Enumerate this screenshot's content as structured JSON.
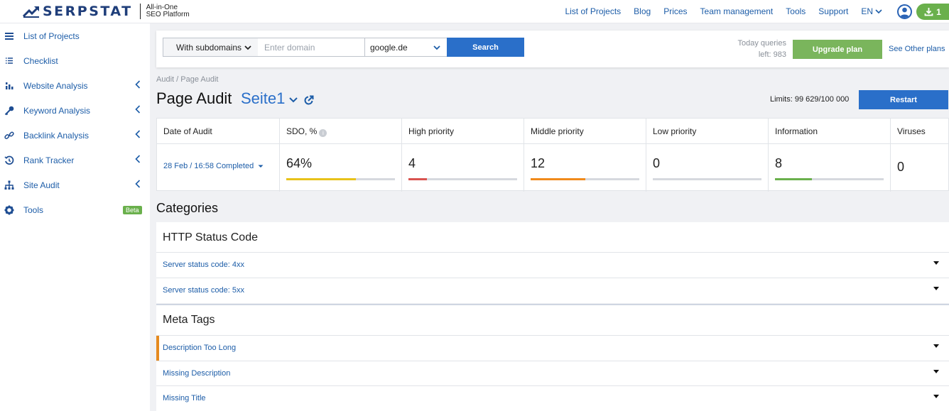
{
  "header": {
    "logo_text": "SERPSTAT",
    "tagline_line1": "All-in-One",
    "tagline_line2": "SEO Platform",
    "nav": [
      "List of Projects",
      "Blog",
      "Prices",
      "Team management",
      "Tools",
      "Support"
    ],
    "language": "EN",
    "notifications_count": "1"
  },
  "sidebar": {
    "items": [
      {
        "label": "List of Projects",
        "icon": "menu-icon"
      },
      {
        "label": "Checklist",
        "icon": "checklist-icon"
      },
      {
        "label": "Website Analysis",
        "icon": "bar-chart-icon"
      },
      {
        "label": "Keyword Analysis",
        "icon": "key-icon"
      },
      {
        "label": "Backlink Analysis",
        "icon": "link-icon"
      },
      {
        "label": "Rank Tracker",
        "icon": "history-icon"
      },
      {
        "label": "Site Audit",
        "icon": "sitemap-icon"
      },
      {
        "label": "Tools",
        "icon": "gear-icon"
      }
    ],
    "beta_label": "Beta"
  },
  "search": {
    "scope": "With subdomains",
    "domain_placeholder": "Enter domain",
    "search_engine": "google.de",
    "search_button": "Search",
    "queries_line1": "Today queries",
    "queries_line2": "left: 983",
    "upgrade_button": "Upgrade plan",
    "other_plans_link": "See Other plans"
  },
  "page": {
    "breadcrumb": "Audit / Page Audit",
    "title": "Page Audit",
    "project": "Seite1",
    "limits": "Limits: 99 629/100 000",
    "restart_button": "Restart"
  },
  "stats": {
    "date_header": "Date of Audit",
    "date_value": "28 Feb / 16:58 Completed",
    "columns": [
      {
        "header": "SDO, %",
        "value": "64%",
        "fill": 0.64,
        "color": "#e8c21a"
      },
      {
        "header": "High priority",
        "value": "4",
        "fill": 0.17,
        "color": "#d9534f"
      },
      {
        "header": "Middle priority",
        "value": "12",
        "fill": 0.5,
        "color": "#f08a1c"
      },
      {
        "header": "Low priority",
        "value": "0",
        "fill": 0,
        "color": "#cccccc"
      },
      {
        "header": "Information",
        "value": "8",
        "fill": 0.34,
        "color": "#6ab04c"
      },
      {
        "header": "Viruses",
        "value": "0"
      }
    ]
  },
  "categories": {
    "heading": "Categories",
    "groups": [
      {
        "title": "HTTP Status Code",
        "rows": [
          "Server status code: 4xx",
          "Server status code: 5xx"
        ]
      },
      {
        "title": "Meta Tags",
        "rows": [
          "Description Too Long",
          "Missing Description",
          "Missing Title"
        ]
      }
    ]
  },
  "colors": {
    "accent": "#2a6fc9",
    "link": "#1d5da8",
    "green": "#7ab55c",
    "warning_mark": "#e58a1f"
  }
}
